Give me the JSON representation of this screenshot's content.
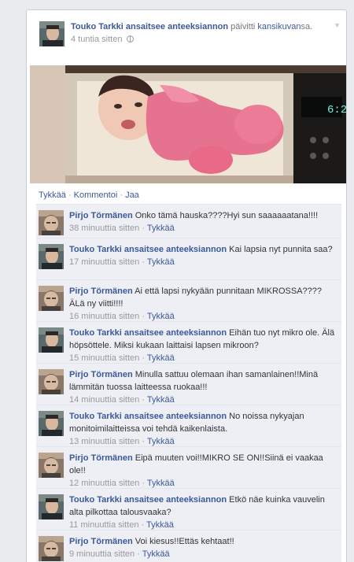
{
  "post": {
    "author": "Touko Tarkki ansaitsee anteeksiannon",
    "action_prefix": " päivitti ",
    "action_link": "kansikuvan",
    "action_suffix": "sa.",
    "time": "4 tuntia sitten",
    "privacy_icon": "globe-icon"
  },
  "actions": {
    "like": "Tykkää",
    "comment": "Kommentoi",
    "share": "Jaa",
    "separator": " · "
  },
  "comments": [
    {
      "author": "Pirjo Törmänen",
      "text": "Onko tämä hauska????Hyi sun saaaaaatana!!!!",
      "time": "38 minuuttia sitten",
      "like": "Tykkää",
      "avatar": "pirjo"
    },
    {
      "author": "Touko Tarkki ansaitsee anteeksiannon",
      "text": "Kai lapsia nyt punnita saa?",
      "time": "17 minuuttia sitten",
      "like": "Tykkää",
      "avatar": "touko"
    },
    {
      "author": "Pirjo Törmänen",
      "text": "Ai että lapsi nykyään punnitaan MIKROSSA???? ÄLä ny viitti!!!!",
      "time": "16 minuuttia sitten",
      "like": "Tykkää",
      "avatar": "pirjo"
    },
    {
      "author": "Touko Tarkki ansaitsee anteeksiannon",
      "text": "Eihän tuo nyt mikro ole. Älä höpsöttele. Miksi kukaan laittaisi lapsen mikroon?",
      "time": "15 minuuttia sitten",
      "like": "Tykkää",
      "avatar": "touko"
    },
    {
      "author": "Pirjo Törmänen",
      "text": "Minulla sattuu olemaan ihan samanlainen!!Minä lämmitän tuossa laitteessa ruokaa!!!",
      "time": "14 minuuttia sitten",
      "like": "Tykkää",
      "avatar": "pirjo"
    },
    {
      "author": "Touko Tarkki ansaitsee anteeksiannon",
      "text": "No noissa nykyajan monitoimilaitteissa voi tehdä kaikenlaista.",
      "time": "13 minuuttia sitten",
      "like": "Tykkää",
      "avatar": "touko"
    },
    {
      "author": "Pirjo Törmänen",
      "text": "Eipä muuten voi!!MIKRO SE ON!!Siinä ei vaakaa ole!!",
      "time": "12 minuuttia sitten",
      "like": "Tykkää",
      "avatar": "pirjo"
    },
    {
      "author": "Touko Tarkki ansaitsee anteeksiannon",
      "text": "Etkö näe kuinka vauvelin alta pilkottaa talousvaaka?",
      "time": "11 minuuttia sitten",
      "like": "Tykkää",
      "avatar": "touko"
    },
    {
      "author": "Pirjo Törmänen",
      "text": "Voi kiesus!!Ettäs kehtaat!!",
      "time": "9 minuuttia sitten",
      "like": "Tykkää",
      "avatar": "pirjo"
    }
  ],
  "colors": {
    "link": "#3b5998",
    "comment_bg": "#edeff4",
    "meta": "#999999"
  }
}
